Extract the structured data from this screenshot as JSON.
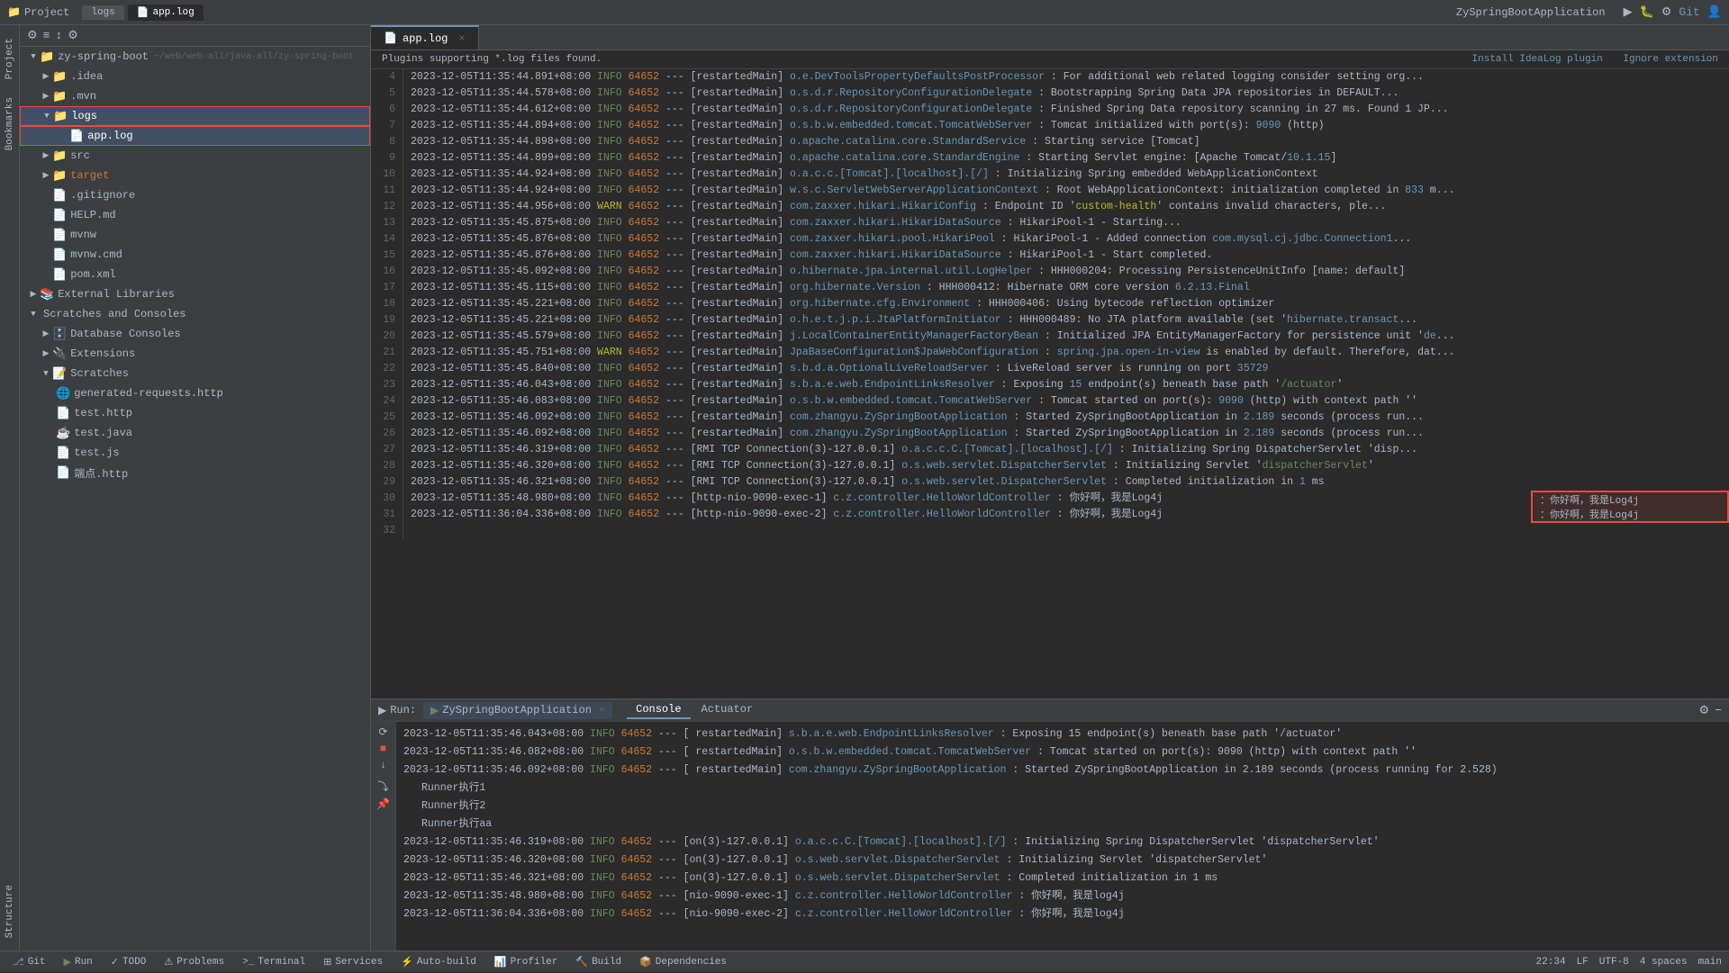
{
  "titleBar": {
    "projectLabel": "Project",
    "repoName": "zy-spring-boot",
    "tabs": [
      {
        "label": "logs",
        "active": false
      },
      {
        "label": "app.log",
        "active": true,
        "icon": "📄"
      }
    ],
    "appName": "ZySpringBootApplication",
    "icons": [
      "⚙",
      "▶",
      "⟳",
      "⚡",
      "🔀",
      "Git"
    ]
  },
  "sidebar": {
    "toolbar": {
      "icons": [
        "⚙",
        "≡",
        "↕",
        "⚙"
      ]
    },
    "tree": [
      {
        "indent": 0,
        "arrow": "▼",
        "icon": "📁",
        "iconClass": "folder-icon",
        "label": "zy-spring-boot",
        "extra": "~/web/web-all/java-all/zy-spring-boot",
        "selected": false
      },
      {
        "indent": 1,
        "arrow": "▶",
        "icon": "📁",
        "iconClass": "folder-icon",
        "label": ".idea",
        "selected": false
      },
      {
        "indent": 1,
        "arrow": "▶",
        "icon": "📁",
        "iconClass": "folder-icon",
        "label": ".mvn",
        "selected": false
      },
      {
        "indent": 1,
        "arrow": "▼",
        "icon": "📁",
        "iconClass": "folder-icon",
        "label": "logs",
        "selected": true,
        "highlighted": true
      },
      {
        "indent": 2,
        "arrow": "",
        "icon": "📄",
        "iconClass": "log-icon",
        "label": "app.log",
        "selected": true,
        "highlighted": true
      },
      {
        "indent": 1,
        "arrow": "▶",
        "icon": "📁",
        "iconClass": "folder-icon",
        "label": "src",
        "selected": false
      },
      {
        "indent": 1,
        "arrow": "▶",
        "icon": "📁",
        "iconClass": "folder-icon",
        "label": "target",
        "selected": false
      },
      {
        "indent": 1,
        "arrow": "",
        "icon": "📄",
        "iconClass": "file-icon",
        "label": ".gitignore",
        "selected": false
      },
      {
        "indent": 1,
        "arrow": "",
        "icon": "📄",
        "iconClass": "file-icon",
        "label": "HELP.md",
        "selected": false
      },
      {
        "indent": 1,
        "arrow": "",
        "icon": "📄",
        "iconClass": "file-icon",
        "label": "mvnw",
        "selected": false
      },
      {
        "indent": 1,
        "arrow": "",
        "icon": "📄",
        "iconClass": "file-icon",
        "label": "mvnw.cmd",
        "selected": false
      },
      {
        "indent": 1,
        "arrow": "",
        "icon": "📄",
        "iconClass": "file-icon",
        "label": "pom.xml",
        "selected": false
      },
      {
        "indent": 0,
        "arrow": "▶",
        "icon": "📚",
        "iconClass": "folder-icon",
        "label": "External Libraries",
        "selected": false
      },
      {
        "indent": 0,
        "arrow": "▼",
        "icon": "",
        "iconClass": "",
        "label": "Scratches and Consoles",
        "selected": false
      },
      {
        "indent": 1,
        "arrow": "▶",
        "icon": "",
        "iconClass": "",
        "label": "Database Consoles",
        "selected": false
      },
      {
        "indent": 1,
        "arrow": "▶",
        "icon": "",
        "iconClass": "",
        "label": "Extensions",
        "selected": false
      },
      {
        "indent": 1,
        "arrow": "▼",
        "icon": "",
        "iconClass": "",
        "label": "Scratches",
        "selected": false
      },
      {
        "indent": 2,
        "arrow": "",
        "icon": "🌐",
        "iconClass": "file-icon",
        "label": "generated-requests.http",
        "selected": false
      },
      {
        "indent": 2,
        "arrow": "",
        "icon": "📄",
        "iconClass": "file-icon",
        "label": "test.http",
        "selected": false
      },
      {
        "indent": 2,
        "arrow": "",
        "icon": "☕",
        "iconClass": "file-icon",
        "label": "test.java",
        "selected": false
      },
      {
        "indent": 2,
        "arrow": "",
        "icon": "📄",
        "iconClass": "file-icon",
        "label": "test.js",
        "selected": false
      },
      {
        "indent": 2,
        "arrow": "",
        "icon": "📄",
        "iconClass": "file-icon",
        "label": "端点.http",
        "selected": false
      }
    ]
  },
  "pluginBar": {
    "message": "Plugins supporting *.log files found.",
    "link1": "Install IdeaLog plugin",
    "link2": "Ignore extension"
  },
  "editorTab": {
    "label": "app.log",
    "close": "×"
  },
  "logLines": [
    {
      "num": 4,
      "date": "2023-12-05T11:35:44.891+08:00",
      "level": "INFO",
      "pid": "64652",
      "thread": "[restartedMain]",
      "class": "o.e.DevToolsPropertyDefaultsPostProcessor",
      "msg": ": For additional web related logging consider setting org...",
      "levelClass": "log-info"
    },
    {
      "num": 5,
      "date": "2023-12-05T11:35:44.578+08:00",
      "level": "INFO",
      "pid": "64652",
      "thread": "[restartedMain]",
      "class": "o.s.d.r.RepositoryConfigurationDelegate",
      "msg": ": Bootstrapping Spring Data JPA repositories in DEFAULT...",
      "levelClass": "log-info"
    },
    {
      "num": 6,
      "date": "2023-12-05T11:35:44.612+08:00",
      "level": "INFO",
      "pid": "64652",
      "thread": "[restartedMain]",
      "class": "o.s.d.r.RepositoryConfigurationDelegate",
      "msg": ": Finished Spring Data repository scanning in 27 ms. Found 1 JP...",
      "levelClass": "log-info"
    },
    {
      "num": 7,
      "date": "2023-12-05T11:35:44.894+08:00",
      "level": "INFO",
      "pid": "64652",
      "thread": "[restartedMain]",
      "class": "o.s.b.w.embedded.tomcat.TomcatWebServer",
      "msg": ": Tomcat initialized with port(s): 9090 (http)",
      "levelClass": "log-info"
    },
    {
      "num": 8,
      "date": "2023-12-05T11:35:44.898+08:00",
      "level": "INFO",
      "pid": "64652",
      "thread": "[restartedMain]",
      "class": "o.apache.catalina.core.StandardService",
      "msg": ": Starting service [Tomcat]",
      "levelClass": "log-info"
    },
    {
      "num": 9,
      "date": "2023-12-05T11:35:44.899+08:00",
      "level": "INFO",
      "pid": "64652",
      "thread": "[restartedMain]",
      "class": "o.apache.catalina.core.StandardEngine",
      "msg": ": Starting Servlet engine: [Apache Tomcat/10.1.15]",
      "levelClass": "log-info"
    },
    {
      "num": 10,
      "date": "2023-12-05T11:35:44.924+08:00",
      "level": "INFO",
      "pid": "64652",
      "thread": "[restartedMain]",
      "class": "o.a.c.c.[Tomcat].[localhost].[/]",
      "msg": ": Initializing Spring embedded WebApplicationContext",
      "levelClass": "log-info"
    },
    {
      "num": 11,
      "date": "2023-12-05T11:35:44.924+08:00",
      "level": "INFO",
      "pid": "64652",
      "thread": "[restartedMain]",
      "class": "w.s.c.ServletWebServerApplicationContext",
      "msg": ": Root WebApplicationContext: initialization completed in 833 m...",
      "levelClass": "log-info"
    },
    {
      "num": 12,
      "date": "2023-12-05T11:35:44.956+08:00",
      "level": "WARN",
      "pid": "64652",
      "thread": "[restartedMain]",
      "class": "com.zaxxer.hikari.HikariConfig",
      "msg": ": Endpoint ID 'custom-health' contains invalid characters, ple...",
      "levelClass": "log-warn"
    },
    {
      "num": 13,
      "date": "2023-12-05T11:35:45.875+08:00",
      "level": "INFO",
      "pid": "64652",
      "thread": "[restartedMain]",
      "class": "com.zaxxer.hikari.HikariDataSource",
      "msg": ": HikariPool-1 - Starting...",
      "levelClass": "log-info"
    },
    {
      "num": 14,
      "date": "2023-12-05T11:35:45.876+08:00",
      "level": "INFO",
      "pid": "64652",
      "thread": "[restartedMain]",
      "class": "com.zaxxer.hikari.pool.HikariPool",
      "msg": ": HikariPool-1 - Added connection com.mysql.cj.jdbc.Connection1...",
      "levelClass": "log-info"
    },
    {
      "num": 15,
      "date": "2023-12-05T11:35:45.876+08:00",
      "level": "INFO",
      "pid": "64652",
      "thread": "[restartedMain]",
      "class": "com.zaxxer.hikari.HikariDataSource",
      "msg": ": HikariPool-1 - Start completed.",
      "levelClass": "log-info"
    },
    {
      "num": 16,
      "date": "2023-12-05T11:35:45.092+08:00",
      "level": "INFO",
      "pid": "64652",
      "thread": "[restartedMain]",
      "class": "o.hibernate.jpa.internal.util.LogHelper",
      "msg": ": HHH000204: Processing PersistenceUnitInfo [name: default]",
      "levelClass": "log-info"
    },
    {
      "num": 17,
      "date": "2023-12-05T11:35:45.115+08:00",
      "level": "INFO",
      "pid": "64652",
      "thread": "[restartedMain]",
      "class": "org.hibernate.Version",
      "msg": ": HHH000412: Hibernate ORM core version 6.2.13.Final",
      "levelClass": "log-info"
    },
    {
      "num": 18,
      "date": "2023-12-05T11:35:45.221+08:00",
      "level": "INFO",
      "pid": "64652",
      "thread": "[restartedMain]",
      "class": "org.hibernate.cfg.Environment",
      "msg": ": HHH000406: Using bytecode reflection optimizer",
      "levelClass": "log-info"
    },
    {
      "num": 19,
      "date": "2023-12-05T11:35:45.221+08:00",
      "level": "INFO",
      "pid": "64652",
      "thread": "[restartedMain]",
      "class": "o.h.e.t.j.p.i.JtaPlatformInitiator",
      "msg": ": HHH000489: No JTA platform available (set 'hibernate.transact...",
      "levelClass": "log-info"
    },
    {
      "num": 20,
      "date": "2023-12-05T11:35:45.579+08:00",
      "level": "INFO",
      "pid": "64652",
      "thread": "[restartedMain]",
      "class": "j.LocalContainerEntityManagerFactoryBean",
      "msg": ": Initialized JPA EntityManagerFactory for persistence unit 'de...",
      "levelClass": "log-info"
    },
    {
      "num": 21,
      "date": "2023-12-05T11:35:45.751+08:00",
      "level": "WARN",
      "pid": "64652",
      "thread": "[restartedMain]",
      "class": "JpaBaseConfiguration$JpaWebConfiguration",
      "msg": ": spring.jpa.open-in-view is enabled by default. Therefore, dat...",
      "levelClass": "log-warn"
    },
    {
      "num": 22,
      "date": "2023-12-05T11:35:45.840+08:00",
      "level": "INFO",
      "pid": "64652",
      "thread": "[restartedMain]",
      "class": "s.b.d.a.OptionalLiveReloadServer",
      "msg": ": LiveReload server is running on port 35729",
      "levelClass": "log-info"
    },
    {
      "num": 23,
      "date": "2023-12-05T11:35:46.043+08:00",
      "level": "INFO",
      "pid": "64652",
      "thread": "[restartedMain]",
      "class": "s.b.a.e.web.EndpointLinksResolver",
      "msg": ": Exposing 15 endpoint(s) beneath base path '/actuator'",
      "levelClass": "log-info"
    },
    {
      "num": 24,
      "date": "2023-12-05T11:35:46.083+08:00",
      "level": "INFO",
      "pid": "64652",
      "thread": "[restartedMain]",
      "class": "o.s.b.w.embedded.tomcat.TomcatWebServer",
      "msg": ": Tomcat started on port(s): 9090 (http) with context path ''",
      "levelClass": "log-info"
    },
    {
      "num": 25,
      "date": "2023-12-05T11:35:46.092+08:00",
      "level": "INFO",
      "pid": "64652",
      "thread": "[restartedMain]",
      "class": "com.zhangyu.ZySpringBootApplication",
      "msg": ": Started ZySpringBootApplication in 2.189 seconds (process run...",
      "levelClass": "log-info"
    },
    {
      "num": 26,
      "date": "2023-12-05T11:35:46.092+08:00",
      "level": "INFO",
      "pid": "64652",
      "thread": "[restartedMain]",
      "class": "com.zhangyu.ZySpringBootApplication",
      "msg": ": Started ZySpringBootApplication in 2.189 seconds (process run...",
      "levelClass": "log-info"
    },
    {
      "num": 27,
      "date": "2023-12-05T11:35:46.319+08:00",
      "level": "INFO",
      "pid": "64652",
      "thread": "[RMI TCP Connection(3)-127.0.0.1]",
      "class": "o.a.c.c.C.[Tomcat].[localhost].[/]",
      "msg": ": Initializing Spring DispatcherServlet 'disp...",
      "levelClass": "log-info"
    },
    {
      "num": 28,
      "date": "2023-12-05T11:35:46.320+08:00",
      "level": "INFO",
      "pid": "64652",
      "thread": "[RMI TCP Connection(3)-127.0.0.1]",
      "class": "o.s.web.servlet.DispatcherServlet",
      "msg": ": Initializing Servlet 'dispatcherServlet'",
      "levelClass": "log-info"
    },
    {
      "num": 29,
      "date": "2023-12-05T11:35:46.321+08:00",
      "level": "INFO",
      "pid": "64652",
      "thread": "[RMI TCP Connection(3)-127.0.0.1]",
      "class": "o.s.web.servlet.DispatcherServlet",
      "msg": ": Completed initialization in 1 ms",
      "levelClass": "log-info"
    },
    {
      "num": 30,
      "date": "2023-12-05T11:35:48.980+08:00",
      "level": "INFO",
      "pid": "64652",
      "thread": "[http-nio-9090-exec-1]",
      "class": "c.z.controller.HelloWorldController",
      "msg": ": 你好啊，我是Log4j",
      "levelClass": "log-info"
    },
    {
      "num": 31,
      "date": "2023-12-05T11:36:04.336+08:00",
      "level": "INFO",
      "pid": "64652",
      "thread": "[http-nio-9090-exec-2]",
      "class": "c.z.controller.HelloWorldController",
      "msg": ": 你好啊，我是Log4j",
      "levelClass": "log-info"
    },
    {
      "num": 32,
      "date": "",
      "level": "",
      "pid": "",
      "thread": "",
      "class": "",
      "msg": "",
      "levelClass": ""
    }
  ],
  "highlightBox": {
    "lines": [
      30,
      31
    ],
    "text1": ": 你好啊，我是Log4j",
    "text2": ": 你好啊，我是Log4j"
  },
  "runPanel": {
    "title": "Run:",
    "appName": "ZySpringBootApplication",
    "tabs": [
      {
        "label": "Console",
        "active": true
      },
      {
        "label": "Actuator",
        "active": false
      }
    ],
    "lines": [
      {
        "type": "log",
        "date": "2023-12-05T11:35:46.043+08:00",
        "level": "INFO",
        "pid": "64652",
        "thread": "[restartedMain]",
        "class": "s.b.a.e.web.EndpointLinksResolver",
        "msg": ": Exposing 15 endpoint(s) beneath base path '/actuator'"
      },
      {
        "type": "log",
        "date": "2023-12-05T11:35:46.082+08:00",
        "level": "INFO",
        "pid": "64652",
        "thread": "[restartedMain]",
        "class": "o.s.b.w.embedded.tomcat.TomcatWebServer",
        "msg": ": Tomcat started on port(s): 9090 (http) with context path ''"
      },
      {
        "type": "log",
        "date": "2023-12-05T11:35:46.092+08:00",
        "level": "INFO",
        "pid": "64652",
        "thread": "[restartedMain]",
        "class": "com.zhangyu.ZySpringBootApplication",
        "msg": ": Started ZySpringBootApplication in 2.189 seconds (process running for 2.528)"
      },
      {
        "type": "plain",
        "text": "Runner执行1"
      },
      {
        "type": "plain",
        "text": "Runner执行2"
      },
      {
        "type": "plain",
        "text": "Runner执行aa"
      },
      {
        "type": "log",
        "date": "2023-12-05T11:35:46.319+08:00",
        "level": "INFO",
        "pid": "64652",
        "thread": "[on(3)-127.0.0.1]",
        "class": "o.a.c.c.C.[Tomcat].[localhost].[/]",
        "msg": ": Initializing Spring DispatcherServlet 'dispatcherServlet'"
      },
      {
        "type": "log",
        "date": "2023-12-05T11:35:46.320+08:00",
        "level": "INFO",
        "pid": "64652",
        "thread": "[on(3)-127.0.0.1]",
        "class": "o.s.web.servlet.DispatcherServlet",
        "msg": ": Initializing Servlet 'dispatcherServlet'"
      },
      {
        "type": "log",
        "date": "2023-12-05T11:35:46.321+08:00",
        "level": "INFO",
        "pid": "64652",
        "thread": "[on(3)-127.0.0.1]",
        "class": "o.s.web.servlet.DispatcherServlet",
        "msg": ": Completed initialization in 1 ms"
      },
      {
        "type": "log",
        "date": "2023-12-05T11:35:48.980+08:00",
        "level": "INFO",
        "pid": "64652",
        "thread": "[nio-9090-exec-1]",
        "class": "c.z.controller.HelloWorldController",
        "msg": ": 你好啊，我是log4j"
      },
      {
        "type": "log",
        "date": "2023-12-05T11:36:04.336+08:00",
        "level": "INFO",
        "pid": "64652",
        "thread": "[nio-9090-exec-2]",
        "class": "c.z.controller.HelloWorldController",
        "msg": ": 你好啊，我是log4j"
      }
    ]
  },
  "statusBar": {
    "git": "Git",
    "run": "Run",
    "runApp": "ZySpringBootApplication",
    "todo": "TODO",
    "problems": "Problems",
    "terminal": "Terminal",
    "services": "Services",
    "autoBuild": "Auto-build",
    "profiler": "Profiler",
    "build": "Build",
    "dependencies": "Dependencies",
    "time": "22:34",
    "encoding": "UTF-8",
    "lineEnding": "LF",
    "indent": "4 spaces",
    "branch": "main",
    "position": "22:34"
  },
  "leftTabs": [
    "Project",
    "Bookmarks",
    "Structure"
  ],
  "colors": {
    "accent": "#6897bb",
    "warning": "#bbb529",
    "success": "#6a8759",
    "danger": "#e74c3c",
    "bg": "#2b2b2b",
    "sidebar": "#3c3f41"
  }
}
